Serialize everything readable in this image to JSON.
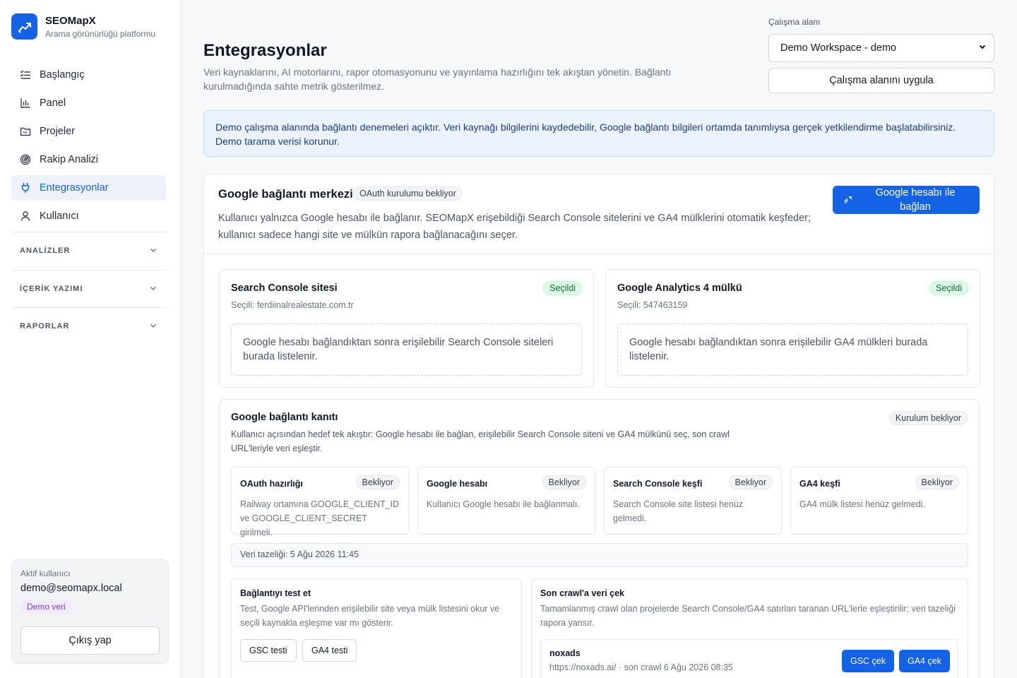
{
  "brand": {
    "name": "SEOMapX",
    "tagline": "Arama görünürlüğü platformu"
  },
  "nav": {
    "items": [
      {
        "label": "Başlangıç",
        "icon": "checklist-icon"
      },
      {
        "label": "Panel",
        "icon": "bar-chart-icon"
      },
      {
        "label": "Projeler",
        "icon": "folder-icon"
      },
      {
        "label": "Rakip Analizi",
        "icon": "radar-icon"
      },
      {
        "label": "Entegrasyonlar",
        "icon": "plug-icon",
        "active": true
      },
      {
        "label": "Kullanıcı",
        "icon": "user-icon"
      }
    ],
    "sections": [
      "ANALİZLER",
      "İÇERİK YAZIMI",
      "RAPORLAR"
    ]
  },
  "user": {
    "label": "Aktif kullanıcı",
    "email": "demo@seomapx.local",
    "badge": "Demo veri",
    "logout": "Çıkış yap"
  },
  "page": {
    "title": "Entegrasyonlar",
    "description": "Veri kaynaklarını, AI motorlarını, rapor otomasyonunu ve yayınlama hazırlığını tek akıştan yönetin. Bağlantı kurulmadığında sahte metrik gösterilmez."
  },
  "workspace": {
    "label": "Çalışma alanı",
    "selected": "Demo Workspace - demo",
    "apply": "Çalışma alanını uygula"
  },
  "alert": "Demo çalışma alanında bağlantı denemeleri açıktır. Veri kaynağı bilgilerini kaydedebilir, Google bağlantı bilgileri ortamda tanımlıysa gerçek yetkilendirme başlatabilirsiniz. Demo tarama verisi korunur.",
  "google": {
    "title": "Google bağlantı merkezi",
    "status": "OAuth kurulumu bekliyor",
    "description": "Kullanıcı yalnızca Google hesabı ile bağlanır. SEOMapX erişebildiği Search Console sitelerini ve GA4 mülklerini otomatik keşfeder; kullanıcı sadece hangi site ve mülkün rapora bağlanacağını seçer.",
    "connect": "Google hesabı ile bağlan"
  },
  "gsc": {
    "title": "Search Console sitesi",
    "status": "Seçildi",
    "selected": "Seçili: ferdiinalrealestate.com.tr",
    "empty": "Google hesabı bağlandıktan sonra erişilebilir Search Console siteleri burada listelenir."
  },
  "ga4": {
    "title": "Google Analytics 4 mülkü",
    "status": "Seçildi",
    "selected": "Seçili: 547463159",
    "empty": "Google hesabı bağlandıktan sonra erişilebilir GA4 mülkleri burada listelenir."
  },
  "proof": {
    "title": "Google bağlantı kanıtı",
    "status": "Kurulum bekliyor",
    "description": "Kullanıcı açısından hedef tek akıştır: Google hesabı ile bağlan, erişilebilir Search Console siteni ve GA4 mülkünü seç, son crawl URL'leriyle veri eşleştir.",
    "steps": [
      {
        "title": "OAuth hazırlığı",
        "status": "Bekliyor",
        "desc": "Railway ortamına GOOGLE_CLIENT_ID ve GOOGLE_CLIENT_SECRET girilmeli."
      },
      {
        "title": "Google hesabı",
        "status": "Bekliyor",
        "desc": "Kullanıcı Google hesabı ile bağlanmalı."
      },
      {
        "title": "Search Console keşfi",
        "status": "Bekliyor",
        "desc": "Search Console site listesi henüz gelmedi."
      },
      {
        "title": "GA4 keşfi",
        "status": "Bekliyor",
        "desc": "GA4 mülk listesi henüz gelmedi."
      }
    ],
    "freshness": "Veri tazeliği: 5 Ağu 2026 11:45"
  },
  "test": {
    "title": "Bağlantıyı test et",
    "description": "Test, Google API'lerinden erişilebilir site veya mülk listesini okur ve seçili kaynakla eşleşme var mı gösterir.",
    "gsc": "GSC testi",
    "ga4": "GA4 testi"
  },
  "crawl": {
    "title": "Son crawl'a veri çek",
    "description": "Tamamlanmış crawl olan projelerde Search Console/GA4 satırları taranan URL'lerle eşleştirilir; veri tazeliği rapora yansır.",
    "project": {
      "name": "noxads",
      "meta": "https://noxads.ai/ · son crawl 6 Ağu 2026 08:35",
      "gsc": "GSC çek",
      "ga4": "GA4 çek"
    }
  },
  "colors": {
    "primary": "#1463e6",
    "success": "#dcfce7",
    "alert_bg": "#eaf3fe"
  }
}
